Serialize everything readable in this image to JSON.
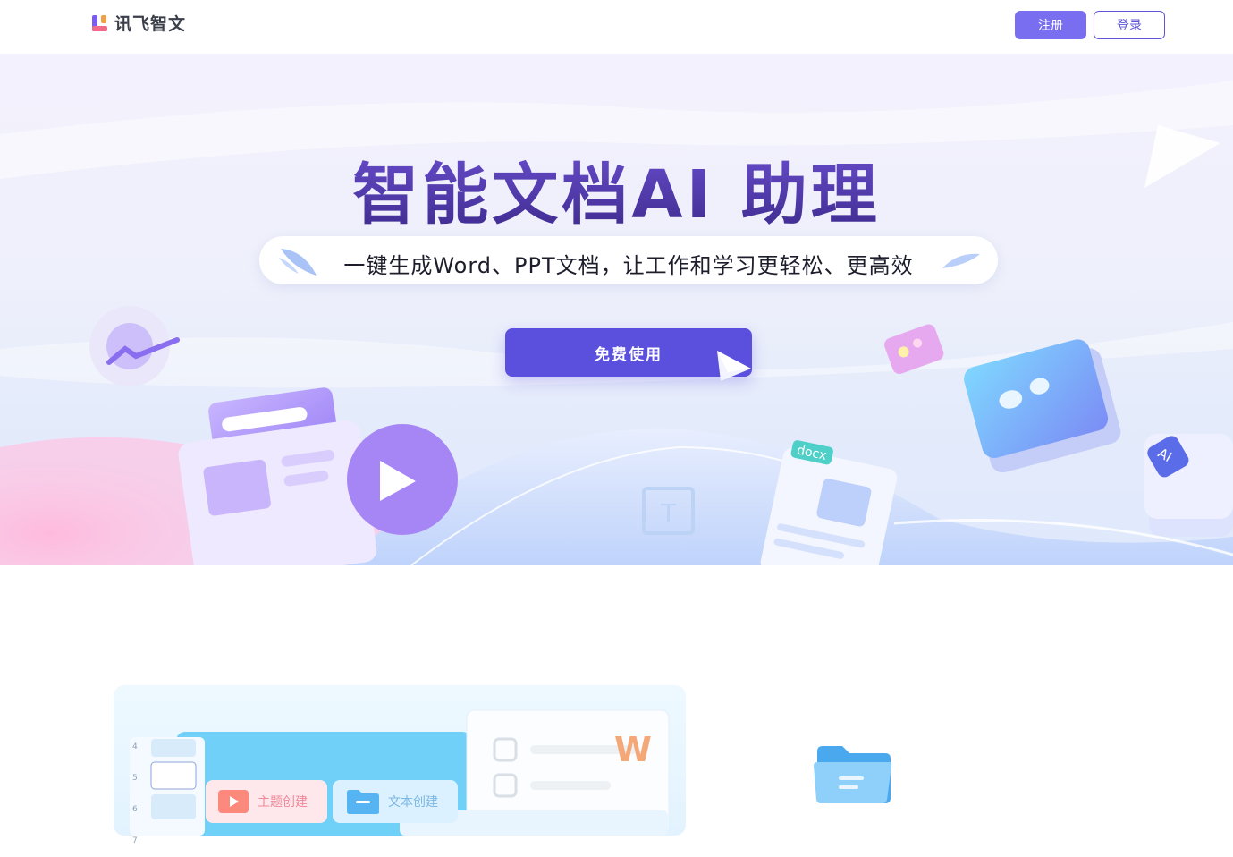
{
  "header": {
    "logo_text": "讯飞智文",
    "register_label": "注册",
    "login_label": "登录"
  },
  "hero": {
    "title": "智能文档AI 助理",
    "subtitle": "一键生成Word、PPT文档，让工作和学习更轻松、更高效",
    "cta_label": "免费使用",
    "decor_docx_label": "docx",
    "decor_ai_label": "AI",
    "decor_text_glyph": "T"
  },
  "feature_preview": {
    "card_theme_label": "主题创建",
    "card_text_label": "文本创建",
    "word_badge": "W",
    "side_numbers": [
      "4",
      "5",
      "6",
      "7"
    ]
  },
  "colors": {
    "brand": "#5b4fde",
    "register_bg": "#7a6ef0",
    "title_purple": "#4f35a8"
  },
  "icons": [
    "logo-icon",
    "paper-plane-icon",
    "folder-icon",
    "image-icon",
    "play-icon",
    "chart-up-icon"
  ]
}
